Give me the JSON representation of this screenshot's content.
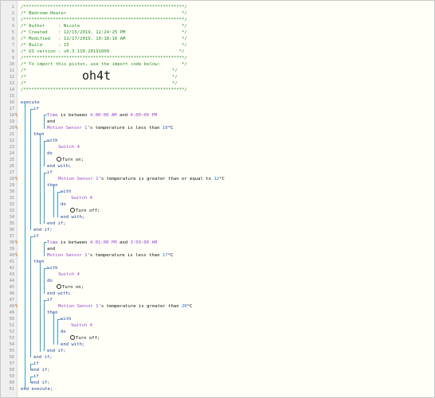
{
  "header": {
    "stars": "/************************************************************/",
    "title": "/* Bedroom Heater                                           */",
    "author": "/* Author     : Nicole                                      */",
    "created": "/* Created    : 12/15/2019, 12:24:25 PM                     */",
    "modified": "/* Modified   : 12/17/2019, 10:18:16 AM                     */",
    "build": "/* Build      : 15                                          */",
    "ui_version": "/* UI version : v0.3.110.20191009                          */",
    "import_note": "/* To import this piston, use the import code below:        */",
    "blank_open": "/*",
    "blank_close": "*/",
    "import_code": "oh4t"
  },
  "kw": {
    "execute": "execute",
    "if": "if",
    "then": "then",
    "and": "and",
    "with": "with",
    "do": "do",
    "end_with": "end with;",
    "end_if": "end if;",
    "end_execute": "end execute;"
  },
  "time1": {
    "pre": "Time",
    "mid": " is between ",
    "a": "4:00:00 AM",
    "and": " and ",
    "b": "4:00:00 PM"
  },
  "cond1": {
    "dev": "Motion Sensor 1",
    "text": "'s temperature is less than ",
    "val": "10",
    "unit": "°C"
  },
  "time2": {
    "pre": "Time",
    "mid": " is between ",
    "a": "4:01:00 PM",
    "and": " and ",
    "b": "3:59:00 AM"
  },
  "cond2": {
    "dev": "Motion Sensor 1",
    "text": "'s temperature is less than ",
    "val": "17",
    "unit": "°C"
  },
  "cond_ge": {
    "dev": "Motion Sensor 1",
    "text": "'s temperature is greater than or equal to ",
    "val": "12",
    "unit": "°C"
  },
  "cond_gt": {
    "dev": "Motion Sensor 1",
    "text": "'s temperature is greater than ",
    "val": "20",
    "unit": "°C"
  },
  "switch": "Switch 4",
  "turn_on": "Turn on;",
  "turn_off": "Turn off;",
  "marker": "%",
  "line_numbers": [
    "1",
    "2",
    "3",
    "4",
    "5",
    "6",
    "7",
    "8",
    "9",
    "10",
    "11",
    "12",
    "13",
    "14",
    "15",
    "16",
    "17",
    "18",
    "19",
    "20",
    "21",
    "22",
    "23",
    "24",
    "25",
    "26",
    "27",
    "28",
    "29",
    "30",
    "31",
    "32",
    "33",
    "34",
    "35",
    "36",
    "37",
    "38",
    "39",
    "40",
    "41",
    "42",
    "43",
    "44",
    "45",
    "46",
    "47",
    "48",
    "49",
    "50",
    "51",
    "52",
    "53",
    "54",
    "55",
    "56",
    "57",
    "58",
    "59",
    "60",
    "61"
  ],
  "colors": {
    "comment": "#2b8a2b",
    "keyword": "#1f3f9a",
    "device": "#9c45c9",
    "number": "#1e6fc9",
    "marker": "#e0701a",
    "guide": "#39a0c9"
  }
}
